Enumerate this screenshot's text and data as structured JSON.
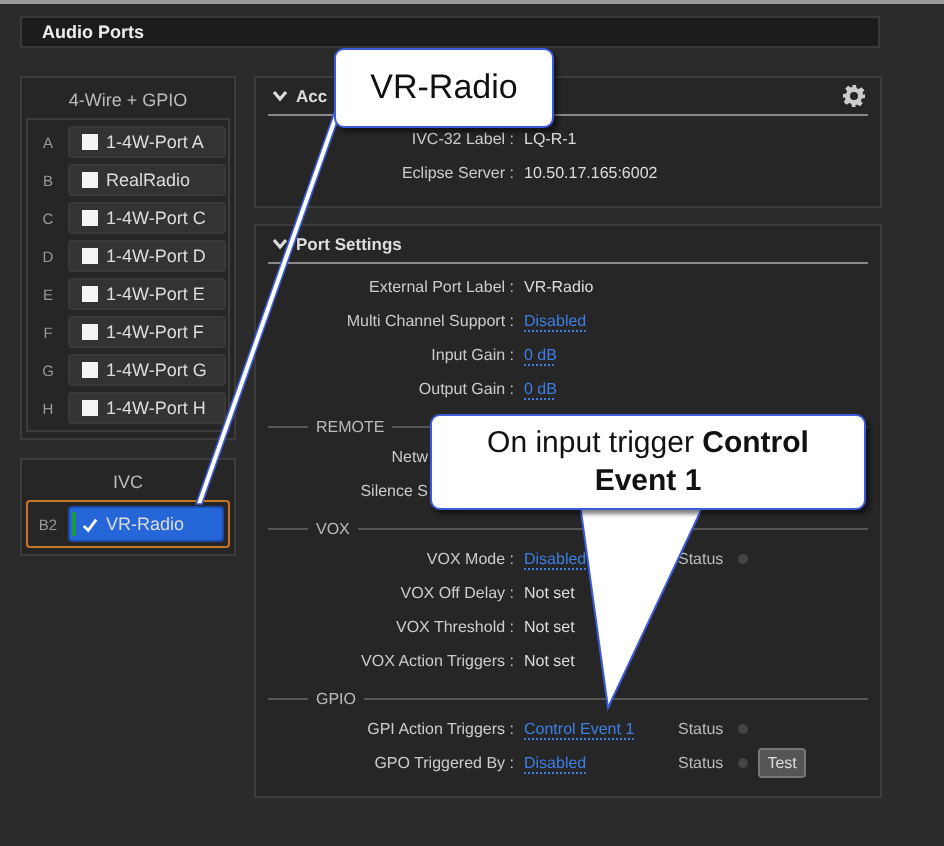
{
  "header": {
    "title": "Audio Ports"
  },
  "port_groups": [
    {
      "title": "4-Wire + GPIO",
      "ports": [
        {
          "slot": "A",
          "label": "1-4W-Port A",
          "checked": false,
          "selected": false
        },
        {
          "slot": "B",
          "label": "RealRadio",
          "checked": false,
          "selected": false
        },
        {
          "slot": "C",
          "label": "1-4W-Port C",
          "checked": false,
          "selected": false
        },
        {
          "slot": "D",
          "label": "1-4W-Port D",
          "checked": false,
          "selected": false
        },
        {
          "slot": "E",
          "label": "1-4W-Port E",
          "checked": false,
          "selected": false
        },
        {
          "slot": "F",
          "label": "1-4W-Port F",
          "checked": false,
          "selected": false
        },
        {
          "slot": "G",
          "label": "1-4W-Port G",
          "checked": false,
          "selected": false
        },
        {
          "slot": "H",
          "label": "1-4W-Port H",
          "checked": false,
          "selected": false
        }
      ]
    },
    {
      "title": "IVC",
      "ports": [
        {
          "slot": "B2",
          "label": "VR-Radio",
          "checked": true,
          "selected": true
        }
      ]
    }
  ],
  "sections": [
    {
      "title": "Acc",
      "expanded": true,
      "groups": [
        {
          "rows": [
            {
              "kind": "text",
              "label": "IVC-32 Label :",
              "value": "LQ-R-1"
            },
            {
              "kind": "text",
              "label": "Eclipse Server :",
              "value": "10.50.17.165:6002"
            }
          ]
        }
      ]
    },
    {
      "title": "Port Settings",
      "expanded": true,
      "groups": [
        {
          "rows": [
            {
              "kind": "text",
              "label": "External Port Label :",
              "value": "VR-Radio"
            },
            {
              "kind": "link",
              "label": "Multi Channel Support :",
              "value": "Disabled"
            },
            {
              "kind": "link",
              "label": "Input Gain :",
              "value": "0 dB"
            },
            {
              "kind": "link",
              "label": "Output Gain :",
              "value": "0 dB"
            }
          ]
        },
        {
          "title": "REMOTE",
          "rows": [
            {
              "kind": "cut",
              "label": "Netw"
            },
            {
              "kind": "cut",
              "label": "Silence S"
            }
          ]
        },
        {
          "title": "VOX",
          "rows": [
            {
              "kind": "link",
              "label": "VOX Mode :",
              "value": "Disabled",
              "status": "Status"
            },
            {
              "kind": "text",
              "label": "VOX Off Delay :",
              "value": "Not set"
            },
            {
              "kind": "text",
              "label": "VOX Threshold :",
              "value": "Not set"
            },
            {
              "kind": "text",
              "label": "VOX Action Triggers :",
              "value": "Not set"
            }
          ]
        },
        {
          "title": "GPIO",
          "rows": [
            {
              "kind": "link",
              "label": "GPI Action Triggers :",
              "value": "Control Event 1",
              "status": "Status"
            },
            {
              "kind": "link",
              "label": "GPO Triggered By :",
              "value": "Disabled",
              "status": "Status",
              "button": "Test"
            }
          ]
        }
      ]
    }
  ],
  "callouts": [
    {
      "text": "VR-Radio"
    },
    {
      "text": "On input trigger **Control Event 1**"
    }
  ]
}
